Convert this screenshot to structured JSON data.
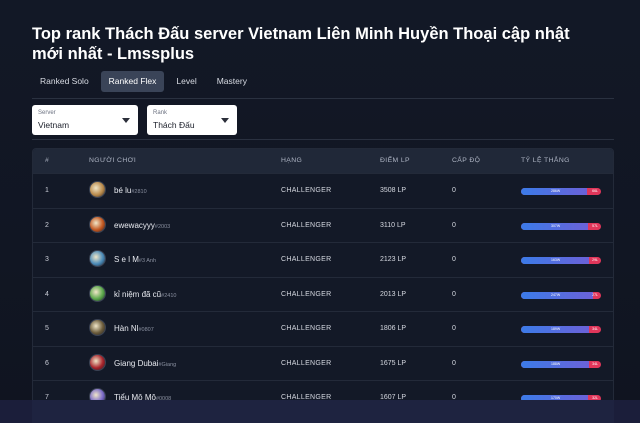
{
  "page": {
    "title": "Top rank Thách Đấu server Vietnam Liên Minh Huyền Thoại cập nhật mới nhất - Lmssplus"
  },
  "tabs": [
    {
      "label": "Ranked Solo",
      "active": false
    },
    {
      "label": "Ranked Flex",
      "active": true
    },
    {
      "label": "Level",
      "active": false
    },
    {
      "label": "Mastery",
      "active": false
    }
  ],
  "filters": {
    "server": {
      "label": "Server",
      "value": "Vietnam"
    },
    "rank": {
      "label": "Rank",
      "value": "Thách Đấu"
    }
  },
  "table": {
    "headers": [
      "#",
      "NGƯỜI CHƠI",
      "HẠNG",
      "ĐIỂM LP",
      "CẤP ĐỘ",
      "TỶ LỆ THẮNG"
    ],
    "rows": [
      {
        "rank": "1",
        "name": "bé lu",
        "tag": "#2810",
        "tier": "CHALLENGER",
        "lp": "3508 LP",
        "level": "0",
        "win_pct": 0.82,
        "wins": "286W",
        "losses": "66L",
        "avatar_color": "#b8894a"
      },
      {
        "rank": "2",
        "name": "ewewacyyy",
        "tag": "#2003",
        "tier": "CHALLENGER",
        "lp": "3110 LP",
        "level": "0",
        "win_pct": 0.84,
        "wins": "307W",
        "losses": "57L",
        "avatar_color": "#c2561f"
      },
      {
        "rank": "3",
        "name": "S e l M",
        "tag": "#3 Anh",
        "tier": "CHALLENGER",
        "lp": "2123 LP",
        "level": "0",
        "win_pct": 0.85,
        "wins": "163W",
        "losses": "29L",
        "avatar_color": "#4a8ab8"
      },
      {
        "rank": "4",
        "name": "kỉ niệm đã cũ",
        "tag": "#2410",
        "tier": "CHALLENGER",
        "lp": "2013 LP",
        "level": "0",
        "win_pct": 0.9,
        "wins": "247W",
        "losses": "27L",
        "avatar_color": "#5aa84a"
      },
      {
        "rank": "5",
        "name": "Hàn Nl",
        "tag": "#0807",
        "tier": "CHALLENGER",
        "lp": "1806 LP",
        "level": "0",
        "win_pct": 0.85,
        "wins": "189W",
        "losses": "34L",
        "avatar_color": "#6a5a3a"
      },
      {
        "rank": "6",
        "name": "Giang Dubai",
        "tag": "#Giang",
        "tier": "CHALLENGER",
        "lp": "1675 LP",
        "level": "0",
        "win_pct": 0.85,
        "wins": "188W",
        "losses": "34L",
        "avatar_color": "#a8222a"
      },
      {
        "rank": "7",
        "name": "Tiểu Mô Mô",
        "tag": "#0008",
        "tier": "CHALLENGER",
        "lp": "1607 LP",
        "level": "0",
        "win_pct": 0.84,
        "wins": "170W",
        "losses": "32L",
        "avatar_color": "#7a6ac8"
      }
    ]
  }
}
